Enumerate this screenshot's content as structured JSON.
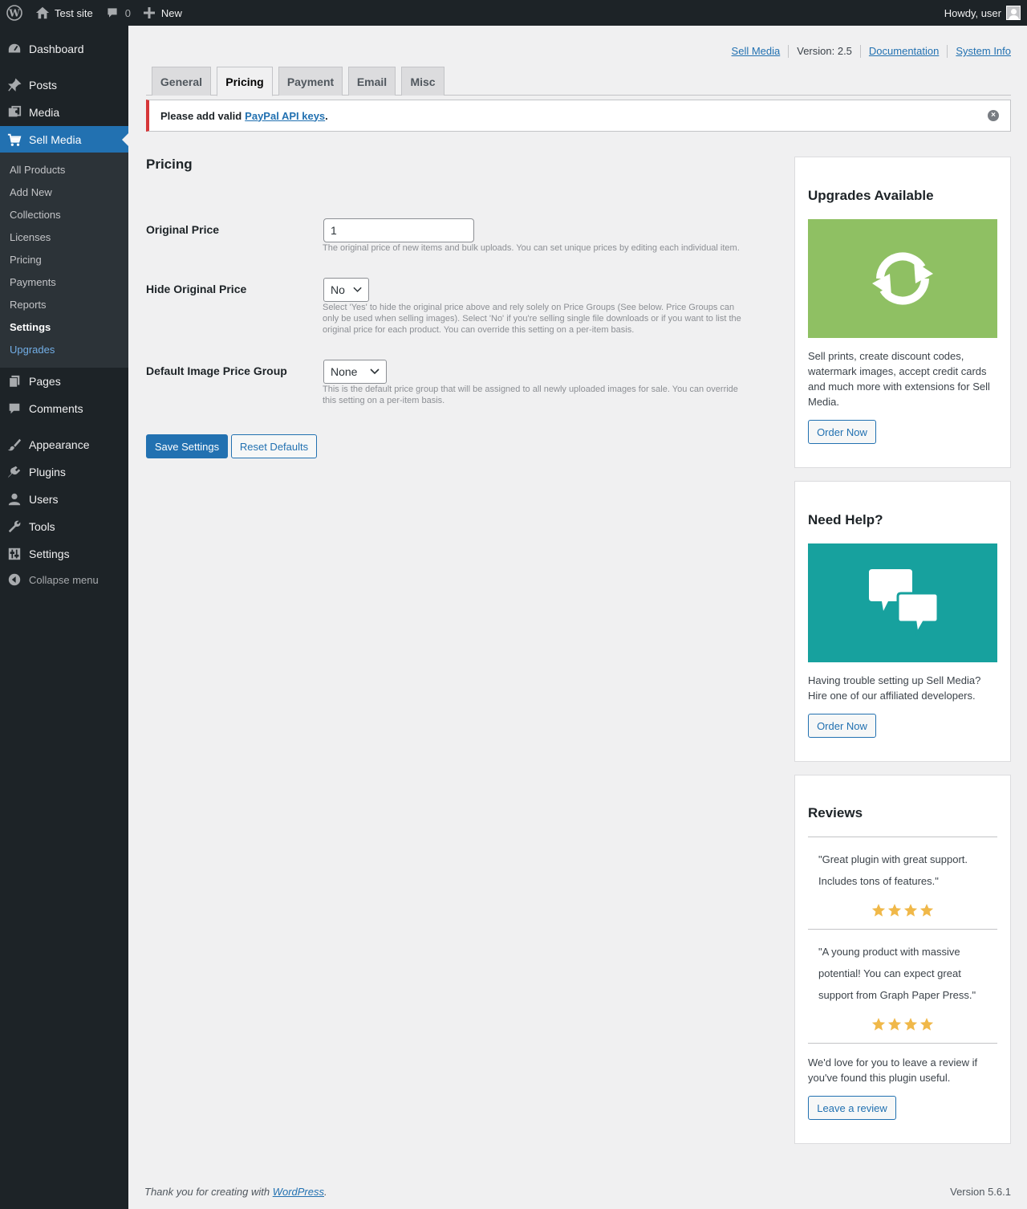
{
  "adminbar": {
    "site_name": "Test site",
    "comments_count": "0",
    "new_label": "New",
    "greeting": "Howdy, user"
  },
  "menu": {
    "items": [
      {
        "label": "Dashboard",
        "icon": "dashboard-icon"
      },
      {
        "label": "Posts",
        "icon": "pushpin-icon"
      },
      {
        "label": "Media",
        "icon": "media-icon"
      },
      {
        "label": "Sell Media",
        "icon": "cart-icon"
      },
      {
        "label": "Pages",
        "icon": "pages-icon"
      },
      {
        "label": "Comments",
        "icon": "comment-icon"
      },
      {
        "label": "Appearance",
        "icon": "brush-icon"
      },
      {
        "label": "Plugins",
        "icon": "plugin-icon"
      },
      {
        "label": "Users",
        "icon": "user-icon"
      },
      {
        "label": "Tools",
        "icon": "wrench-icon"
      },
      {
        "label": "Settings",
        "icon": "settings-icon"
      }
    ],
    "submenu": [
      "All Products",
      "Add New",
      "Collections",
      "Licenses",
      "Pricing",
      "Payments",
      "Reports",
      "Settings",
      "Upgrades"
    ],
    "collapse_label": "Collapse menu"
  },
  "top_links": {
    "sell_media": "Sell Media",
    "version": "Version: 2.5",
    "documentation": "Documentation",
    "system_info": "System Info"
  },
  "tabs": [
    "General",
    "Pricing",
    "Payment",
    "Email",
    "Misc"
  ],
  "active_tab": "Pricing",
  "notice": {
    "text": "Please add valid",
    "link": "PayPal API keys",
    "suffix": "."
  },
  "form": {
    "title": "Pricing",
    "original_price": {
      "label": "Original Price",
      "value": "1",
      "description": "The original price of new items and bulk uploads. You can set unique prices by editing each individual item."
    },
    "hide_original_price": {
      "label": "Hide Original Price",
      "value": "No",
      "description": "Select 'Yes' to hide the original price above and rely solely on Price Groups (See below. Price Groups can only be used when selling images). Select 'No' if you're selling single file downloads or if you want to list the original price for each product. You can override this setting on a per-item basis."
    },
    "default_price_group": {
      "label": "Default Image Price Group",
      "value": "None",
      "description": "This is the default price group that will be assigned to all newly uploaded images for sale. You can override this setting on a per-item basis."
    },
    "save_label": "Save Settings",
    "reset_label": "Reset Defaults"
  },
  "sidebar": {
    "upgrades": {
      "title": "Upgrades Available",
      "text": "Sell prints, create discount codes, watermark images, accept credit cards and much more with extensions for Sell Media.",
      "button": "Order Now",
      "banner_color": "#8fc063"
    },
    "help": {
      "title": "Need Help?",
      "text": "Having trouble setting up Sell Media? Hire one of our affiliated developers.",
      "button": "Order Now",
      "banner_color": "#17a19e"
    },
    "reviews": {
      "title": "Reviews",
      "quotes": [
        {
          "text": "\"Great plugin with great support. Includes tons of features.\"",
          "stars": 4
        },
        {
          "text": "\"A young product with massive potential! You can expect great support from Graph Paper Press.\"",
          "stars": 4
        }
      ],
      "cta": "We'd love for you to leave a review if you've found this plugin useful.",
      "button": "Leave a review"
    }
  },
  "footer": {
    "thanks_prefix": "Thank you for creating with",
    "link": "WordPress",
    "suffix": ".",
    "version": "Version 5.6.1"
  }
}
